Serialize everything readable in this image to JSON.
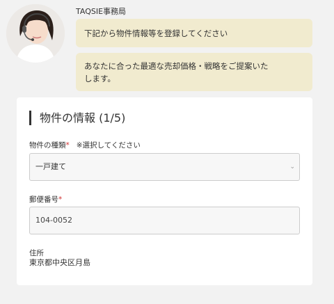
{
  "header": {
    "sender_name": "TAQSIE事務局"
  },
  "messages": [
    "下記から物件情報等を登録してください",
    "あなたに合った最適な売却価格・戦略をご提案いたします。"
  ],
  "form": {
    "section_title": "物件の情報 (1/5)",
    "property_type": {
      "label": "物件の種類",
      "required_mark": "*",
      "note": "※選択してください",
      "selected": "一戸建て"
    },
    "postal_code": {
      "label": "郵便番号",
      "required_mark": "*",
      "value": "104-0052"
    },
    "address": {
      "label": "住所",
      "value": "東京都中央区月島"
    }
  }
}
